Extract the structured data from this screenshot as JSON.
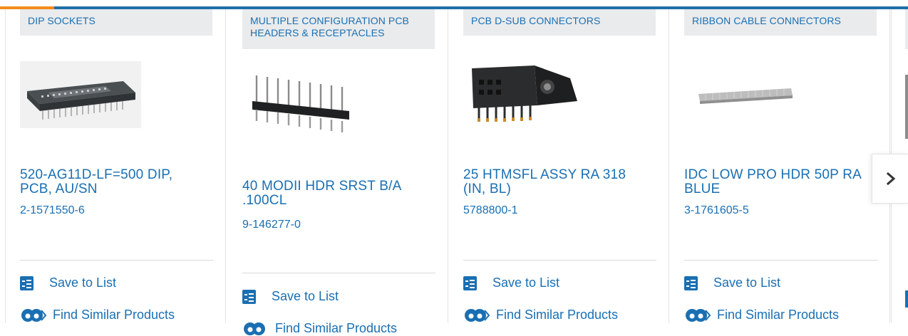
{
  "colors": {
    "link": "#1a6fb2",
    "brand_bar": "#1e6fa8",
    "accent": "#f28c1b",
    "category_bg": "#e9ebed"
  },
  "cards": [
    {
      "category": "DIP SOCKETS",
      "title_lines": [
        "520-AG11D-LF=500 DIP,",
        "PCB, AU/SN"
      ],
      "part_number": "2-1571550-6",
      "save_label": "Save to List",
      "find_label": "Find Similar Products",
      "image_icon": "dip-socket-image"
    },
    {
      "category": "MULTIPLE CONFIGURATION PCB HEADERS & RECEPTACLES",
      "title_lines": [
        "40 MODII HDR SRST B/A",
        ".100CL"
      ],
      "part_number": "9-146277-0",
      "save_label": "Save to List",
      "find_label": "Find Similar Products",
      "image_icon": "pin-header-image"
    },
    {
      "category": "PCB D-SUB CONNECTORS",
      "title_lines": [
        "25 HTMSFL ASSY RA 318",
        "(IN, BL)"
      ],
      "part_number": "5788800-1",
      "save_label": "Save to List",
      "find_label": "Find Similar Products",
      "image_icon": "dsub-connector-image"
    },
    {
      "category": "RIBBON CABLE CONNECTORS",
      "title_lines": [
        "IDC LOW PRO HDR 50P RA",
        "BLUE"
      ],
      "part_number": "3-1761605-5",
      "save_label": "Save to List",
      "find_label": "Find Similar Products",
      "image_icon": "ribbon-connector-image"
    }
  ],
  "carousel": {
    "next_icon": "chevron-right-icon"
  }
}
